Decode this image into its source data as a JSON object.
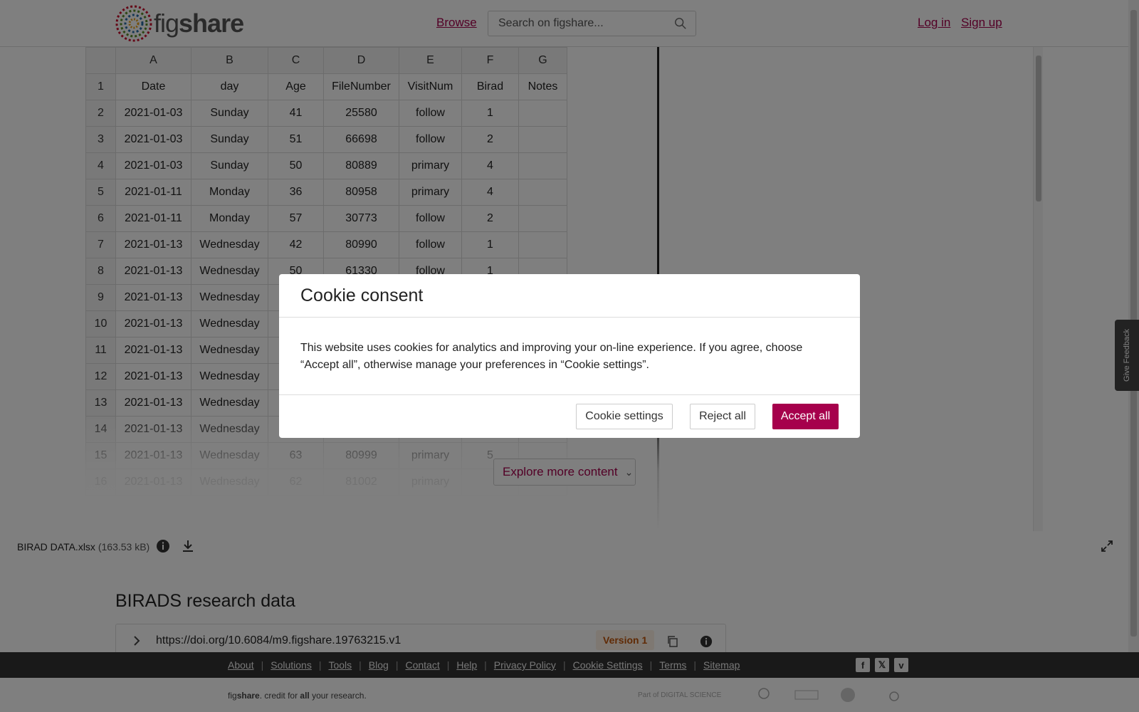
{
  "header": {
    "logo_text_light": "fig",
    "logo_text_bold": "share",
    "browse_label": "Browse",
    "search_placeholder": "Search on figshare...",
    "login_label": "Log in",
    "signup_label": "Sign up"
  },
  "spreadsheet": {
    "col_headers": [
      "",
      "A",
      "B",
      "C",
      "D",
      "E",
      "F",
      "G"
    ],
    "rows": [
      [
        "1",
        "Date",
        "day",
        "Age",
        "FileNumber",
        "VisitNum",
        "Birad",
        "Notes"
      ],
      [
        "2",
        "2021-01-03",
        "Sunday",
        "41",
        "25580",
        "follow",
        "1",
        ""
      ],
      [
        "3",
        "2021-01-03",
        "Sunday",
        "51",
        "66698",
        "follow",
        "2",
        ""
      ],
      [
        "4",
        "2021-01-03",
        "Sunday",
        "50",
        "80889",
        "primary",
        "4",
        ""
      ],
      [
        "5",
        "2021-01-11",
        "Monday",
        "36",
        "80958",
        "primary",
        "4",
        ""
      ],
      [
        "6",
        "2021-01-11",
        "Monday",
        "57",
        "30773",
        "follow",
        "2",
        ""
      ],
      [
        "7",
        "2021-01-13",
        "Wednesday",
        "42",
        "80990",
        "follow",
        "1",
        ""
      ],
      [
        "8",
        "2021-01-13",
        "Wednesday",
        "50",
        "61330",
        "follow",
        "1",
        ""
      ],
      [
        "9",
        "2021-01-13",
        "Wednesday",
        "",
        "",
        "",
        "",
        ""
      ],
      [
        "10",
        "2021-01-13",
        "Wednesday",
        "",
        "",
        "",
        "",
        ""
      ],
      [
        "11",
        "2021-01-13",
        "Wednesday",
        "",
        "",
        "",
        "",
        ""
      ],
      [
        "12",
        "2021-01-13",
        "Wednesday",
        "",
        "",
        "",
        "",
        ""
      ],
      [
        "13",
        "2021-01-13",
        "Wednesday",
        "",
        "",
        "",
        "",
        ""
      ],
      [
        "14",
        "2021-01-13",
        "Wednesday",
        "",
        "",
        "",
        "",
        ""
      ],
      [
        "15",
        "2021-01-13",
        "Wednesday",
        "63",
        "80999",
        "primary",
        "5",
        ""
      ],
      [
        "16",
        "2021-01-13",
        "Wednesday",
        "62",
        "81002",
        "primary",
        "",
        ""
      ]
    ]
  },
  "explore_label": "Explore more content",
  "file": {
    "name": "BIRAD DATA.xlsx",
    "size": "(163.53 kB)"
  },
  "item": {
    "title": "BIRADS research data",
    "doi": "https://doi.org/10.6084/m9.figshare.19763215.v1",
    "version": "Version 1"
  },
  "feedback_label": "Give Feedback",
  "footer": {
    "links": [
      "About",
      "Solutions",
      "Tools",
      "Blog",
      "Contact",
      "Help",
      "Privacy Policy",
      "Cookie Settings",
      "Terms",
      "Sitemap"
    ],
    "credit_pre": "fig",
    "credit_bold": "share",
    "credit_mid": ". credit for ",
    "credit_all": "all",
    "credit_post": " your research.",
    "partner_text": "Part of DIGITAL SCIENCE"
  },
  "cookie": {
    "title": "Cookie consent",
    "body": "This website uses cookies for analytics and improving your on-line experience. If you agree, choose “Accept all”, otherwise manage your preferences in “Cookie settings”.",
    "settings_label": "Cookie settings",
    "reject_label": "Reject all",
    "accept_label": "Accept all"
  },
  "colors": {
    "brand": "#a6004c",
    "version_text": "#c0550a"
  }
}
